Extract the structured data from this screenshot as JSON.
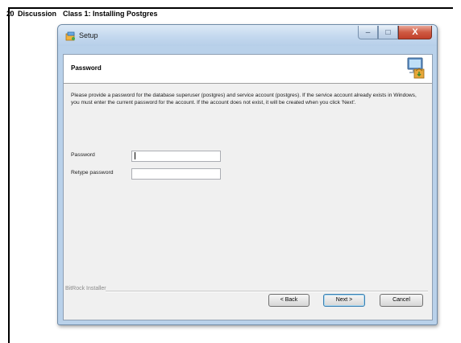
{
  "slide": {
    "page_number": "20",
    "heading_part1": "Discussion",
    "heading_part2": "Class 1: Installing Postgres"
  },
  "window": {
    "title": "Setup",
    "controls": {
      "minimize": "–",
      "maximize": "□",
      "close": "X"
    }
  },
  "page": {
    "title": "Password",
    "description": "Please provide a password for the database superuser (postgres) and service account (postgres). If the service account already exists in Windows, you must enter the current password for the account. If the account does not exist, it will be created when you click 'Next'.",
    "fields": [
      {
        "label": "Password",
        "value": "",
        "placeholder": ""
      },
      {
        "label": "Retype password",
        "value": "",
        "placeholder": ""
      }
    ]
  },
  "footer": {
    "installer_label": "BitRock Installer",
    "buttons": {
      "back": "< Back",
      "next": "Next >",
      "cancel": "Cancel"
    }
  },
  "icons": {
    "app": "setup-app-icon",
    "header": "computer-install-icon"
  },
  "colors": {
    "titlebar": "#c2d7ee",
    "close_button": "#cf5a42",
    "client_background": "#f0f0f0"
  }
}
